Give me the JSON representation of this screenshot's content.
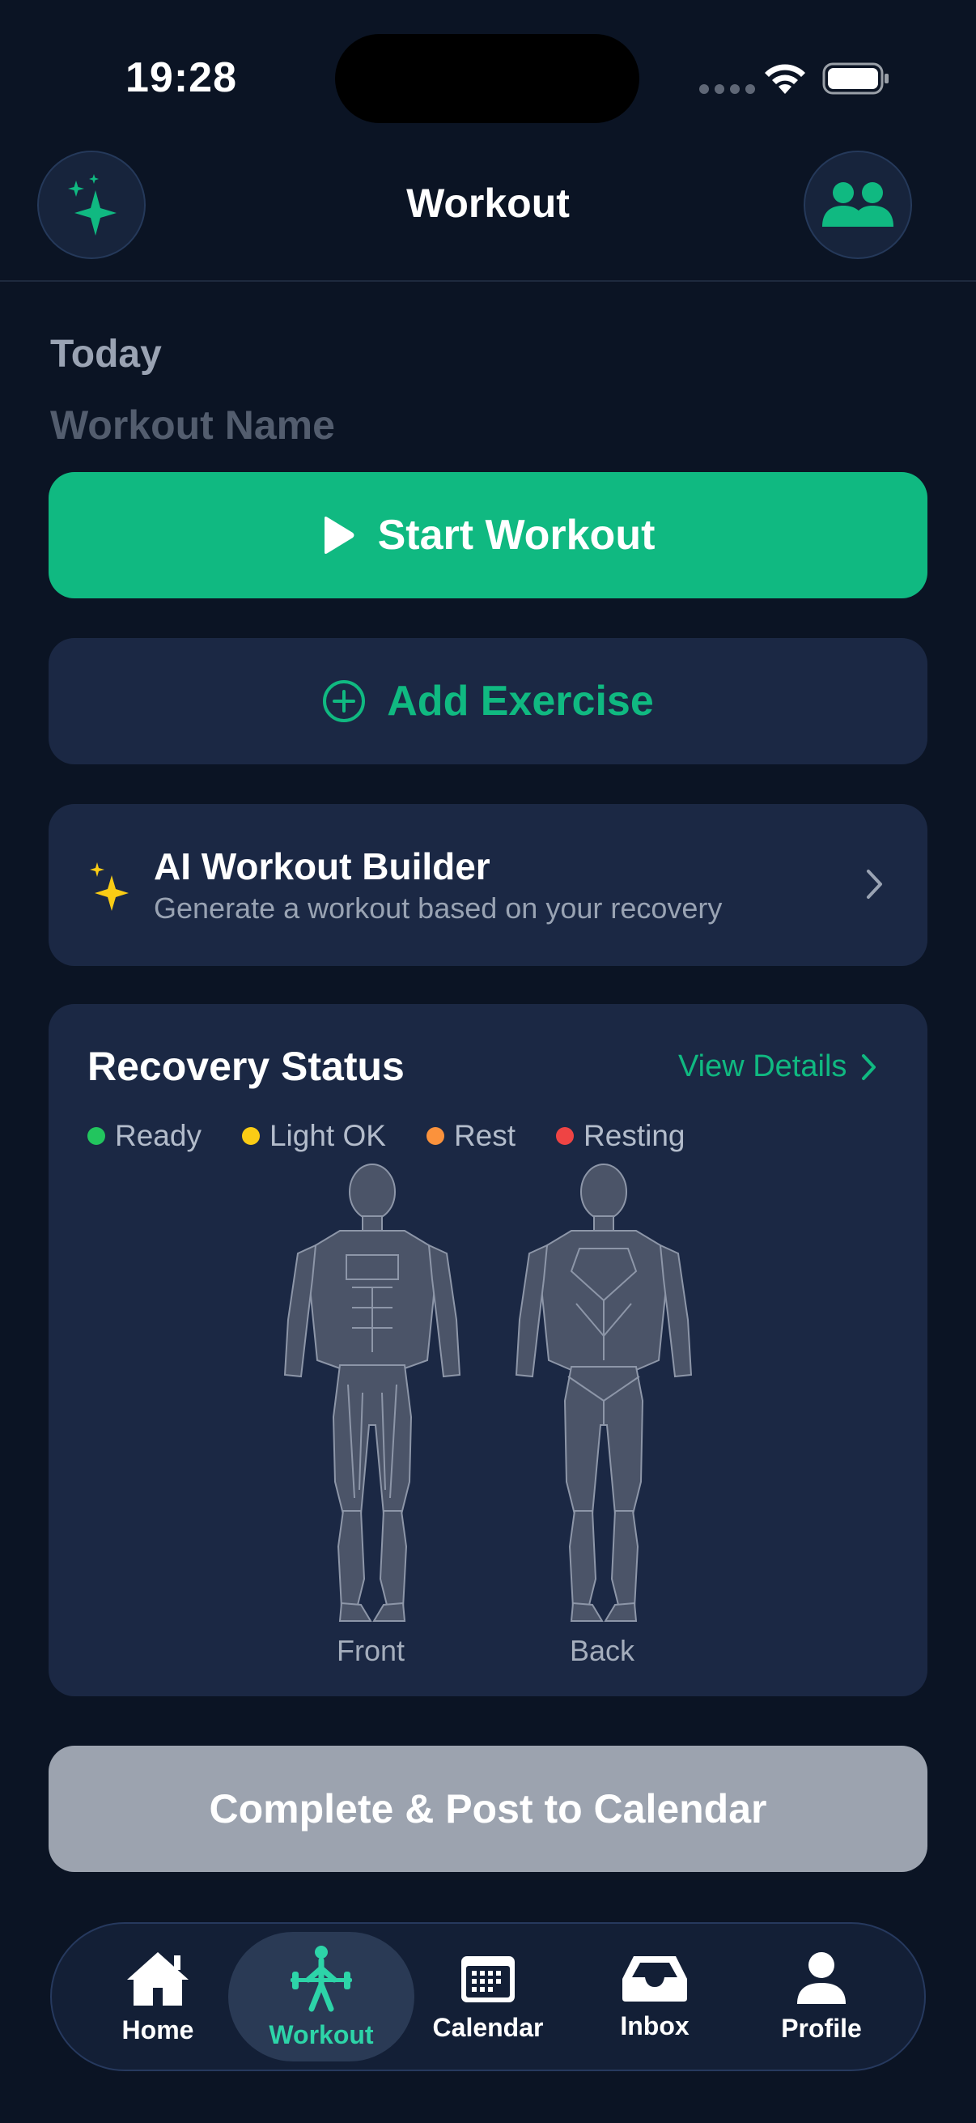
{
  "status_bar": {
    "time": "19:28"
  },
  "header": {
    "title": "Workout"
  },
  "workout": {
    "date_label": "Today",
    "name_placeholder": "Workout Name"
  },
  "buttons": {
    "start_workout": "Start Workout",
    "add_exercise": "Add Exercise",
    "complete": "Complete & Post to Calendar"
  },
  "ai_builder": {
    "title": "AI Workout Builder",
    "subtitle": "Generate a workout based on your recovery"
  },
  "recovery": {
    "title": "Recovery Status",
    "view_details": "View Details",
    "legend": [
      {
        "label": "Ready",
        "color": "#22c55e"
      },
      {
        "label": "Light OK",
        "color": "#facc15"
      },
      {
        "label": "Rest",
        "color": "#fb923c"
      },
      {
        "label": "Resting",
        "color": "#ef4444"
      }
    ],
    "front_label": "Front",
    "back_label": "Back"
  },
  "tabs": [
    {
      "label": "Home",
      "icon": "home-icon"
    },
    {
      "label": "Workout",
      "icon": "barbell-icon",
      "active": true
    },
    {
      "label": "Calendar",
      "icon": "calendar-icon"
    },
    {
      "label": "Inbox",
      "icon": "inbox-icon"
    },
    {
      "label": "Profile",
      "icon": "profile-icon"
    }
  ],
  "colors": {
    "accent": "#10b981",
    "background": "#0b1424",
    "card": "#1b2844",
    "disabled_button": "#9ca3af"
  }
}
